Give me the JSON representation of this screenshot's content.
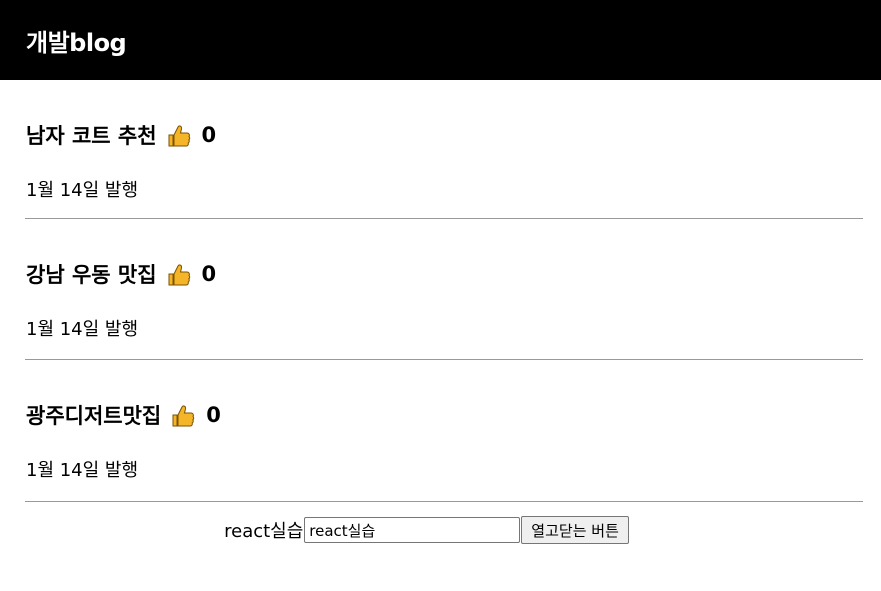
{
  "nav": {
    "title": "개발blog"
  },
  "posts": [
    {
      "title": "남자 코트 추천",
      "likes": "0",
      "date": "1월 14일 발행"
    },
    {
      "title": "강남 우동 맛집",
      "likes": "0",
      "date": "1월 14일 발행"
    },
    {
      "title": "광주디저트맛집",
      "likes": "0",
      "date": "1월 14일 발행"
    }
  ],
  "bottom": {
    "label": "react실습",
    "input_value": "react실습",
    "button_label": "열고닫는 버튼"
  },
  "icons": {
    "like": "thumbs-up-icon"
  },
  "colors": {
    "nav_bg": "#000000",
    "nav_text": "#ffffff",
    "divider": "#999999",
    "thumb": "#f5b529"
  }
}
